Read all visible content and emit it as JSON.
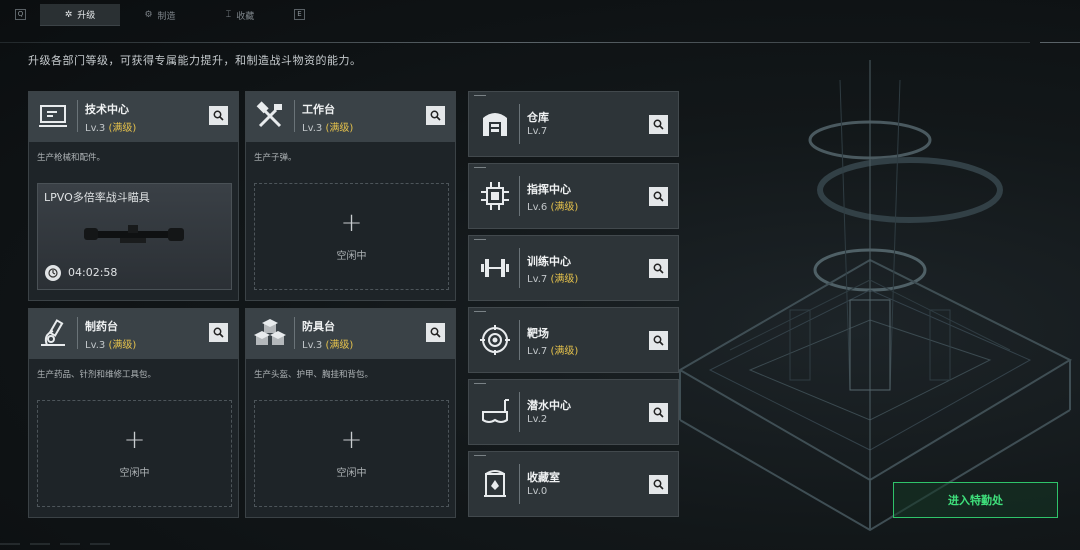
{
  "topbar": {
    "left_key": "Q",
    "right_key": "E",
    "tabs": [
      {
        "label": "升级",
        "icon": "upgrade-icon"
      },
      {
        "label": "制造",
        "icon": "craft-icon"
      },
      {
        "label": "收藏",
        "icon": "collection-icon"
      }
    ]
  },
  "subtitle": "升级各部门等级，可获得专属能力提升，和制造战斗物资的能力。",
  "facilities": [
    {
      "name": "技术中心",
      "level": "Lv.3",
      "max": "(满级)",
      "desc": "生产枪械和配件。",
      "icon": "tech-center-icon",
      "slot": {
        "state": "crafting",
        "item": "LPVO多倍率战斗瞄具",
        "timer": "04:02:58"
      }
    },
    {
      "name": "工作台",
      "level": "Lv.3",
      "max": "(满级)",
      "desc": "生产子弹。",
      "icon": "workbench-icon",
      "slot": {
        "state": "idle",
        "plus": "+",
        "label": "空闲中"
      }
    },
    {
      "name": "制药台",
      "level": "Lv.3",
      "max": "(满级)",
      "desc": "生产药品、针剂和维修工具包。",
      "icon": "pharmacy-icon",
      "slot": {
        "state": "idle",
        "plus": "+",
        "label": "空闲中"
      }
    },
    {
      "name": "防具台",
      "level": "Lv.3",
      "max": "(满级)",
      "desc": "生产头盔、护甲、胸挂和背包。",
      "icon": "armor-bench-icon",
      "slot": {
        "state": "idle",
        "plus": "+",
        "label": "空闲中"
      }
    }
  ],
  "side_facilities": [
    {
      "name": "仓库",
      "level": "Lv.7",
      "max": "",
      "icon": "warehouse-icon"
    },
    {
      "name": "指挥中心",
      "level": "Lv.6",
      "max": "(满级)",
      "icon": "command-center-icon"
    },
    {
      "name": "训练中心",
      "level": "Lv.7",
      "max": "(满级)",
      "icon": "training-center-icon"
    },
    {
      "name": "靶场",
      "level": "Lv.7",
      "max": "(满级)",
      "icon": "shooting-range-icon"
    },
    {
      "name": "潜水中心",
      "level": "Lv.2",
      "max": "",
      "icon": "diving-center-icon"
    },
    {
      "name": "收藏室",
      "level": "Lv.0",
      "max": "",
      "icon": "collection-room-icon"
    }
  ],
  "enter_button": "进入特勤处",
  "colors": {
    "accent_max": "#e4c14c",
    "enter_green": "#3fe07c"
  }
}
